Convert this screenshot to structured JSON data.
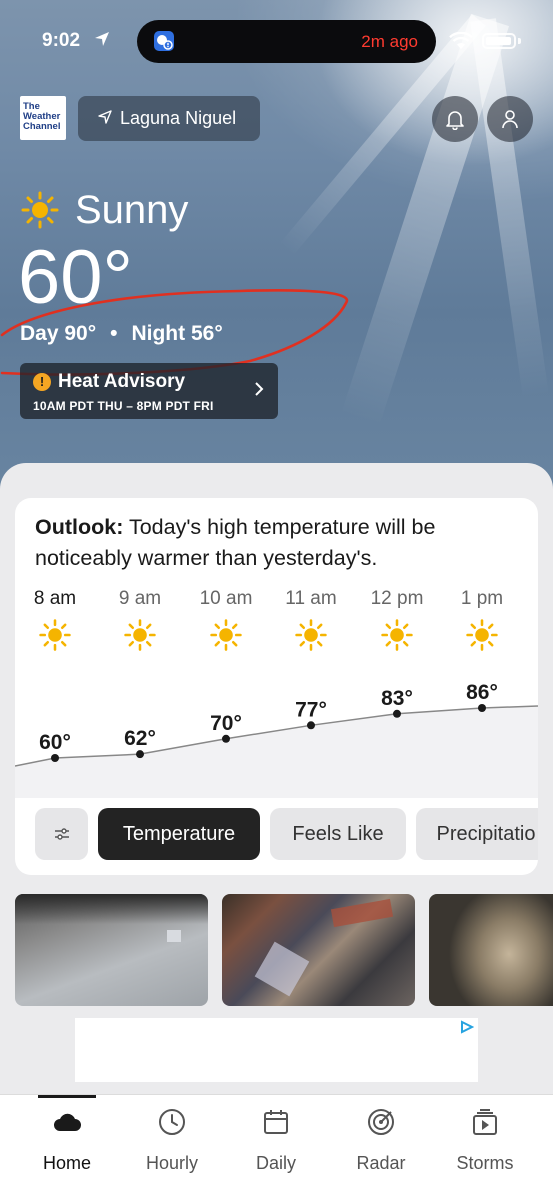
{
  "status_bar": {
    "time": "9:02",
    "island_text": "2m ago"
  },
  "header": {
    "logo_lines": [
      "The",
      "Weather",
      "Channel"
    ],
    "location": "Laguna Niguel"
  },
  "current": {
    "condition": "Sunny",
    "temperature": "60°",
    "day_label": "Day 90°",
    "separator": "•",
    "night_label": "Night 56°"
  },
  "advisory": {
    "icon": "!",
    "title": "Heat Advisory",
    "subtitle": "10AM PDT THU – 8PM PDT FRI"
  },
  "outlook": {
    "label": "Outlook:",
    "text": " Today's high temperature will be noticeably warmer than yesterday's."
  },
  "hourly": [
    {
      "time": "8 am",
      "temp": "60°"
    },
    {
      "time": "9 am",
      "temp": "62°"
    },
    {
      "time": "10 am",
      "temp": "70°"
    },
    {
      "time": "11 am",
      "temp": "77°"
    },
    {
      "time": "12 pm",
      "temp": "83°"
    },
    {
      "time": "1 pm",
      "temp": "86°"
    }
  ],
  "chart_data": {
    "type": "line",
    "categories": [
      "8 am",
      "9 am",
      "10 am",
      "11 am",
      "12 pm",
      "1 pm"
    ],
    "series": [
      {
        "values": [
          60,
          62,
          70,
          77,
          83,
          86
        ]
      }
    ]
  },
  "filters": {
    "temperature": "Temperature",
    "feels_like": "Feels Like",
    "precipitation": "Precipitatio"
  },
  "tabs": [
    {
      "label": "Home",
      "icon": "cloud-icon"
    },
    {
      "label": "Hourly",
      "icon": "clock-icon"
    },
    {
      "label": "Daily",
      "icon": "calendar-icon"
    },
    {
      "label": "Radar",
      "icon": "radar-icon"
    },
    {
      "label": "Storms",
      "icon": "video-icon"
    }
  ],
  "colors": {
    "sun": "#f5b400",
    "annotation": "#e03020",
    "active_pill": "#232323"
  }
}
